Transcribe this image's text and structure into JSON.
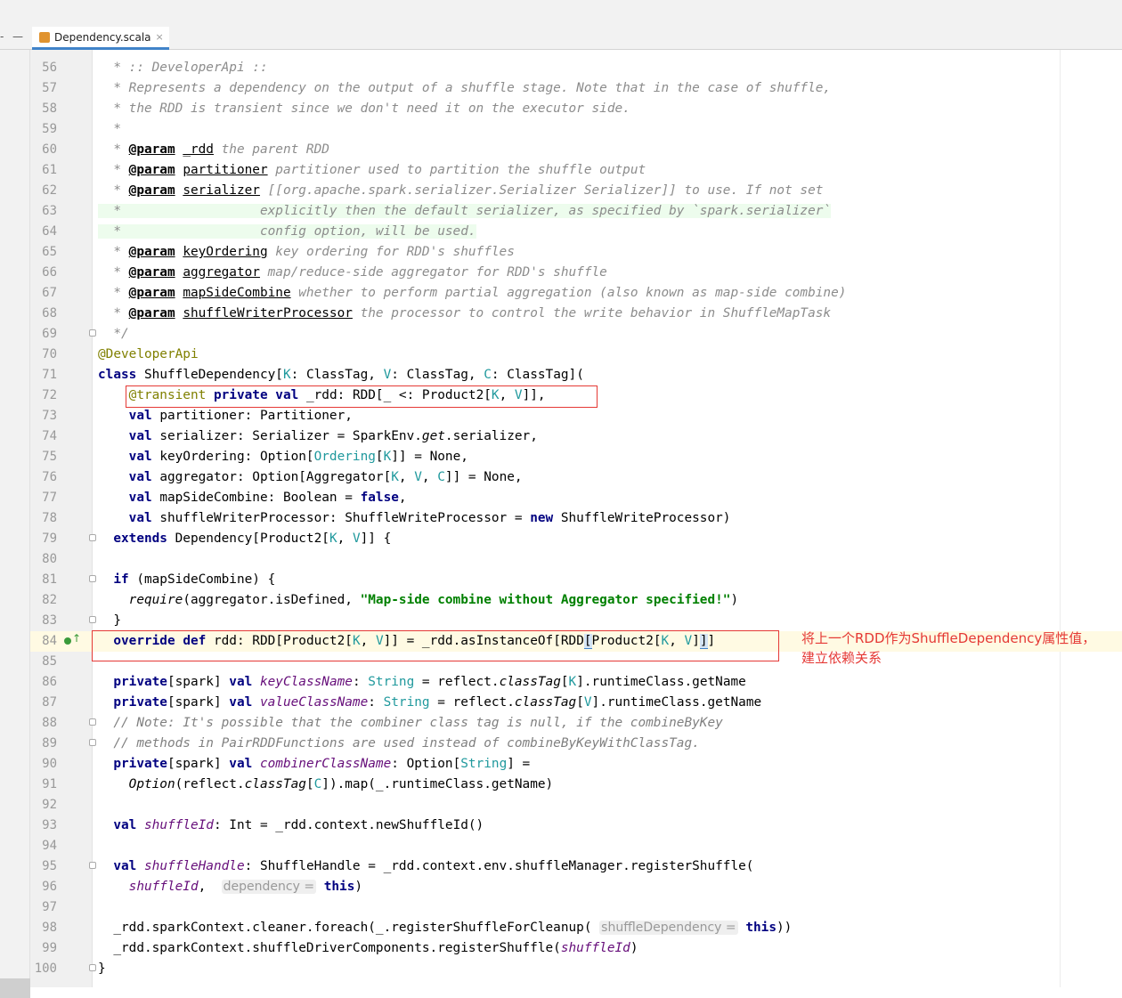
{
  "editor": {
    "tab": {
      "name": "Dependency.scala",
      "close": "×"
    },
    "left_buttons": [
      "-",
      "—"
    ]
  },
  "annotation": {
    "text_line1": "将上一个RDD作为ShuffleDependency属性值，",
    "text_line2": "建立依赖关系"
  },
  "lines": [
    {
      "n": "56",
      "segs": [
        {
          "t": "  * :: DeveloperApi ::",
          "c": "doc"
        }
      ]
    },
    {
      "n": "57",
      "segs": [
        {
          "t": "  * Represents a dependency on the output of a shuffle stage. Note that in the case of shuffle,",
          "c": "doc"
        }
      ]
    },
    {
      "n": "58",
      "segs": [
        {
          "t": "  * the RDD is transient since we don't need it on the executor side.",
          "c": "doc"
        }
      ]
    },
    {
      "n": "59",
      "segs": [
        {
          "t": "  *",
          "c": "doc"
        }
      ]
    },
    {
      "n": "60",
      "segs": [
        {
          "t": "  * ",
          "c": "doc"
        },
        {
          "t": "@param",
          "c": "tag"
        },
        {
          "t": " ",
          "c": "doc"
        },
        {
          "t": "_rdd",
          "c": "pn"
        },
        {
          "t": " the parent RDD",
          "c": "doc"
        }
      ]
    },
    {
      "n": "61",
      "segs": [
        {
          "t": "  * ",
          "c": "doc"
        },
        {
          "t": "@param",
          "c": "tag"
        },
        {
          "t": " ",
          "c": "doc"
        },
        {
          "t": "partitioner",
          "c": "pn"
        },
        {
          "t": " partitioner used to partition the shuffle output",
          "c": "doc"
        }
      ]
    },
    {
      "n": "62",
      "segs": [
        {
          "t": "  * ",
          "c": "doc"
        },
        {
          "t": "@param",
          "c": "tag"
        },
        {
          "t": " ",
          "c": "doc"
        },
        {
          "t": "serializer",
          "c": "pn"
        },
        {
          "t": " [[org.apache.spark.serializer.Serializer Serializer]] to use. If not set",
          "c": "doc"
        }
      ]
    },
    {
      "n": "63",
      "segs": [
        {
          "t": "  *                  explicitly then the default serializer, as specified by `spark.serializer`",
          "c": "doc"
        }
      ]
    },
    {
      "n": "64",
      "segs": [
        {
          "t": "  *                  config option, will be used.",
          "c": "doc"
        }
      ]
    },
    {
      "n": "65",
      "segs": [
        {
          "t": "  * ",
          "c": "doc"
        },
        {
          "t": "@param",
          "c": "tag"
        },
        {
          "t": " ",
          "c": "doc"
        },
        {
          "t": "keyOrdering",
          "c": "pn"
        },
        {
          "t": " key ordering for RDD's shuffles",
          "c": "doc"
        }
      ]
    },
    {
      "n": "66",
      "segs": [
        {
          "t": "  * ",
          "c": "doc"
        },
        {
          "t": "@param",
          "c": "tag"
        },
        {
          "t": " ",
          "c": "doc"
        },
        {
          "t": "aggregator",
          "c": "pn"
        },
        {
          "t": " map/reduce-side aggregator for RDD's shuffle",
          "c": "doc"
        }
      ]
    },
    {
      "n": "67",
      "segs": [
        {
          "t": "  * ",
          "c": "doc"
        },
        {
          "t": "@param",
          "c": "tag"
        },
        {
          "t": " ",
          "c": "doc"
        },
        {
          "t": "mapSideCombine",
          "c": "pn"
        },
        {
          "t": " whether to perform partial aggregation (also known as map-side combine)",
          "c": "doc"
        }
      ]
    },
    {
      "n": "68",
      "segs": [
        {
          "t": "  * ",
          "c": "doc"
        },
        {
          "t": "@param",
          "c": "tag"
        },
        {
          "t": " ",
          "c": "doc"
        },
        {
          "t": "shuffleWriterProcessor",
          "c": "pn"
        },
        {
          "t": " the processor to control the write behavior in ShuffleMapTask",
          "c": "doc"
        }
      ]
    },
    {
      "n": "69",
      "segs": [
        {
          "t": "  */",
          "c": "doc"
        }
      ]
    },
    {
      "n": "70",
      "segs": [
        {
          "t": "@DeveloperApi",
          "c": "ann"
        }
      ]
    },
    {
      "n": "71",
      "segs": [
        {
          "t": "class",
          "c": "kw"
        },
        {
          "t": " ShuffleDependency["
        },
        {
          "t": "K",
          "c": "tp"
        },
        {
          "t": ": ClassTag, "
        },
        {
          "t": "V",
          "c": "tp"
        },
        {
          "t": ": ClassTag, "
        },
        {
          "t": "C",
          "c": "tp"
        },
        {
          "t": ": ClassTag]("
        }
      ]
    },
    {
      "n": "72",
      "segs": [
        {
          "t": "    "
        },
        {
          "t": "@transient",
          "c": "ann"
        },
        {
          "t": " "
        },
        {
          "t": "private",
          "c": "kw"
        },
        {
          "t": " "
        },
        {
          "t": "val",
          "c": "kw"
        },
        {
          "t": " _rdd: RDD[_ <: Product2["
        },
        {
          "t": "K",
          "c": "tp"
        },
        {
          "t": ", "
        },
        {
          "t": "V",
          "c": "tp"
        },
        {
          "t": "]],"
        }
      ]
    },
    {
      "n": "73",
      "segs": [
        {
          "t": "    "
        },
        {
          "t": "val",
          "c": "kw"
        },
        {
          "t": " partitioner: Partitioner,"
        }
      ]
    },
    {
      "n": "74",
      "segs": [
        {
          "t": "    "
        },
        {
          "t": "val",
          "c": "kw"
        },
        {
          "t": " serializer: Serializer = SparkEnv."
        },
        {
          "t": "get",
          "c": "it"
        },
        {
          "t": ".serializer,"
        }
      ]
    },
    {
      "n": "75",
      "segs": [
        {
          "t": "    "
        },
        {
          "t": "val",
          "c": "kw"
        },
        {
          "t": " keyOrdering: Option["
        },
        {
          "t": "Ordering",
          "c": "tp"
        },
        {
          "t": "["
        },
        {
          "t": "K",
          "c": "tp"
        },
        {
          "t": "]] = None,"
        }
      ]
    },
    {
      "n": "76",
      "segs": [
        {
          "t": "    "
        },
        {
          "t": "val",
          "c": "kw"
        },
        {
          "t": " aggregator: Option[Aggregator["
        },
        {
          "t": "K",
          "c": "tp"
        },
        {
          "t": ", "
        },
        {
          "t": "V",
          "c": "tp"
        },
        {
          "t": ", "
        },
        {
          "t": "C",
          "c": "tp"
        },
        {
          "t": "]] = None,"
        }
      ]
    },
    {
      "n": "77",
      "segs": [
        {
          "t": "    "
        },
        {
          "t": "val",
          "c": "kw"
        },
        {
          "t": " mapSideCombine: Boolean = "
        },
        {
          "t": "false",
          "c": "kw"
        },
        {
          "t": ","
        }
      ]
    },
    {
      "n": "78",
      "segs": [
        {
          "t": "    "
        },
        {
          "t": "val",
          "c": "kw"
        },
        {
          "t": " shuffleWriterProcessor: ShuffleWriteProcessor = "
        },
        {
          "t": "new",
          "c": "kw"
        },
        {
          "t": " ShuffleWriteProcessor)"
        }
      ]
    },
    {
      "n": "79",
      "segs": [
        {
          "t": "  "
        },
        {
          "t": "extends",
          "c": "kw"
        },
        {
          "t": " Dependency[Product2["
        },
        {
          "t": "K",
          "c": "tp"
        },
        {
          "t": ", "
        },
        {
          "t": "V",
          "c": "tp"
        },
        {
          "t": "]] {"
        }
      ]
    },
    {
      "n": "80",
      "segs": []
    },
    {
      "n": "81",
      "segs": [
        {
          "t": "  "
        },
        {
          "t": "if",
          "c": "kw"
        },
        {
          "t": " (mapSideCombine) {"
        }
      ]
    },
    {
      "n": "82",
      "segs": [
        {
          "t": "    "
        },
        {
          "t": "require",
          "c": "it"
        },
        {
          "t": "(aggregator.isDefined, "
        },
        {
          "t": "\"Map-side combine without Aggregator specified!\"",
          "c": "str"
        },
        {
          "t": ")"
        }
      ]
    },
    {
      "n": "83",
      "segs": [
        {
          "t": "  }"
        }
      ]
    },
    {
      "n": "84",
      "segs": [
        {
          "t": "  "
        },
        {
          "t": "override",
          "c": "kw"
        },
        {
          "t": " "
        },
        {
          "t": "def",
          "c": "kw"
        },
        {
          "t": " rdd: RDD[Product2["
        },
        {
          "t": "K",
          "c": "tp"
        },
        {
          "t": ", "
        },
        {
          "t": "V",
          "c": "tp"
        },
        {
          "t": "]] = _rdd.asInstanceOf[RDD"
        },
        {
          "t": "[",
          "c": "brk"
        },
        {
          "t": "Product2["
        },
        {
          "t": "K",
          "c": "tp"
        },
        {
          "t": ", "
        },
        {
          "t": "V",
          "c": "tp"
        },
        {
          "t": "]"
        },
        {
          "t": "]",
          "c": "brk"
        },
        {
          "t": "]"
        }
      ]
    },
    {
      "n": "85",
      "segs": []
    },
    {
      "n": "86",
      "segs": [
        {
          "t": "  "
        },
        {
          "t": "private",
          "c": "kw"
        },
        {
          "t": "[spark] "
        },
        {
          "t": "val",
          "c": "kw"
        },
        {
          "t": " "
        },
        {
          "t": "keyClassName",
          "c": "fld"
        },
        {
          "t": ": "
        },
        {
          "t": "String",
          "c": "tp"
        },
        {
          "t": " = reflect."
        },
        {
          "t": "classTag",
          "c": "it"
        },
        {
          "t": "["
        },
        {
          "t": "K",
          "c": "tp"
        },
        {
          "t": "].runtimeClass.getName"
        }
      ]
    },
    {
      "n": "87",
      "segs": [
        {
          "t": "  "
        },
        {
          "t": "private",
          "c": "kw"
        },
        {
          "t": "[spark] "
        },
        {
          "t": "val",
          "c": "kw"
        },
        {
          "t": " "
        },
        {
          "t": "valueClassName",
          "c": "fld"
        },
        {
          "t": ": "
        },
        {
          "t": "String",
          "c": "tp"
        },
        {
          "t": " = reflect."
        },
        {
          "t": "classTag",
          "c": "it"
        },
        {
          "t": "["
        },
        {
          "t": "V",
          "c": "tp"
        },
        {
          "t": "].runtimeClass.getName"
        }
      ]
    },
    {
      "n": "88",
      "segs": [
        {
          "t": "  // Note: It's possible that the combiner class tag is null, if the combineByKey",
          "c": "cmt"
        }
      ]
    },
    {
      "n": "89",
      "segs": [
        {
          "t": "  // methods in PairRDDFunctions are used instead of combineByKeyWithClassTag.",
          "c": "cmt"
        }
      ]
    },
    {
      "n": "90",
      "segs": [
        {
          "t": "  "
        },
        {
          "t": "private",
          "c": "kw"
        },
        {
          "t": "[spark] "
        },
        {
          "t": "val",
          "c": "kw"
        },
        {
          "t": " "
        },
        {
          "t": "combinerClassName",
          "c": "fld"
        },
        {
          "t": ": Option["
        },
        {
          "t": "String",
          "c": "tp"
        },
        {
          "t": "] ="
        }
      ]
    },
    {
      "n": "91",
      "segs": [
        {
          "t": "    "
        },
        {
          "t": "Option",
          "c": "it"
        },
        {
          "t": "(reflect."
        },
        {
          "t": "classTag",
          "c": "it"
        },
        {
          "t": "["
        },
        {
          "t": "C",
          "c": "tp"
        },
        {
          "t": "]).map(_.runtimeClass.getName)"
        }
      ]
    },
    {
      "n": "92",
      "segs": []
    },
    {
      "n": "93",
      "segs": [
        {
          "t": "  "
        },
        {
          "t": "val",
          "c": "kw"
        },
        {
          "t": " "
        },
        {
          "t": "shuffleId",
          "c": "fld"
        },
        {
          "t": ": Int = _rdd.context.newShuffleId()"
        }
      ]
    },
    {
      "n": "94",
      "segs": []
    },
    {
      "n": "95",
      "segs": [
        {
          "t": "  "
        },
        {
          "t": "val",
          "c": "kw"
        },
        {
          "t": " "
        },
        {
          "t": "shuffleHandle",
          "c": "fld"
        },
        {
          "t": ": ShuffleHandle = _rdd.context.env.shuffleManager.registerShuffle("
        }
      ]
    },
    {
      "n": "96",
      "segs": [
        {
          "t": "    "
        },
        {
          "t": "shuffleId",
          "c": "fld"
        },
        {
          "t": ",  "
        },
        {
          "t": "dependency =",
          "c": "hint"
        },
        {
          "t": " "
        },
        {
          "t": "this",
          "c": "kw"
        },
        {
          "t": ")"
        }
      ]
    },
    {
      "n": "97",
      "segs": []
    },
    {
      "n": "98",
      "segs": [
        {
          "t": "  _rdd.sparkContext.cleaner.foreach(_.registerShuffleForCleanup( "
        },
        {
          "t": "shuffleDependency =",
          "c": "hint"
        },
        {
          "t": " "
        },
        {
          "t": "this",
          "c": "kw"
        },
        {
          "t": "))"
        }
      ]
    },
    {
      "n": "99",
      "segs": [
        {
          "t": "  _rdd.sparkContext.shuffleDriverComponents.registerShuffle("
        },
        {
          "t": "shuffleId",
          "c": "fld"
        },
        {
          "t": ")"
        }
      ]
    },
    {
      "n": "100",
      "segs": [
        {
          "t": "}"
        }
      ]
    }
  ]
}
